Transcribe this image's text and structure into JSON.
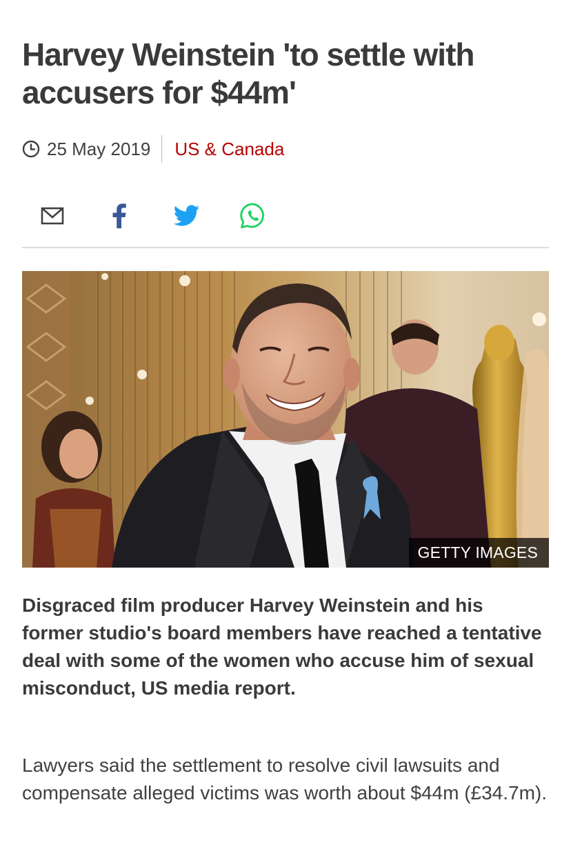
{
  "article": {
    "headline": "Harvey Weinstein 'to settle with accusers for $44m'",
    "date": "25 May 2019",
    "section": "US & Canada",
    "lead": "Disgraced film producer Harvey Weinstein and his former studio's board members have reached a tentative deal with some of the women who accuse him of sexual misconduct, US media report.",
    "body": "Lawyers said the settlement to resolve civil lawsuits and compensate alleged victims was worth about $44m (£34.7m)."
  },
  "image": {
    "credit": "GETTY IMAGES"
  },
  "share": {
    "icons": [
      "email-icon",
      "facebook-icon",
      "twitter-icon",
      "whatsapp-icon"
    ]
  },
  "colors": {
    "section": "#b80000",
    "facebook": "#3b5998",
    "twitter": "#1da1f2",
    "whatsapp": "#25d366",
    "headline": "#3a3a3a"
  }
}
